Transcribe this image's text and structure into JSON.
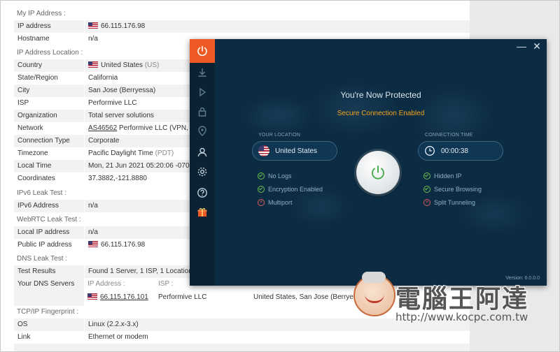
{
  "page": {
    "sections": {
      "my_ip": "My IP Address :",
      "ip_location": "IP Address Location :",
      "ipv6": "IPv6 Leak Test :",
      "webrtc": "WebRTC Leak Test :",
      "dns": "DNS Leak Test :",
      "tcp": "TCP/IP Fingerprint :"
    },
    "rows": {
      "ip_address": {
        "k": "IP address",
        "v": "66.115.176.98"
      },
      "hostname": {
        "k": "Hostname",
        "v": "n/a"
      },
      "country": {
        "k": "Country",
        "v": "United States",
        "v2": "(US)"
      },
      "state": {
        "k": "State/Region",
        "v": "California"
      },
      "city": {
        "k": "City",
        "v": "San Jose (Berryessa)"
      },
      "isp": {
        "k": "ISP",
        "v": "Performive LLC"
      },
      "org": {
        "k": "Organization",
        "v": "Total server solutions"
      },
      "network": {
        "k": "Network",
        "v_link": "AS46562",
        "v": "Performive LLC (VPN, A1"
      },
      "conn_type": {
        "k": "Connection Type",
        "v": "Corporate"
      },
      "timezone": {
        "k": "Timezone",
        "v": "Pacific Daylight Time",
        "v2": "(PDT)"
      },
      "local_time": {
        "k": "Local Time",
        "v": "Mon, 21 Jun 2021 05:20:06 -0700"
      },
      "coords": {
        "k": "Coordinates",
        "v": "37.3882,-121.8880"
      },
      "ipv6_addr": {
        "k": "IPv6 Address",
        "v": "n/a"
      },
      "local_ip": {
        "k": "Local IP address",
        "v": "n/a"
      },
      "public_ip": {
        "k": "Public IP address",
        "v": "66.115.176.98"
      },
      "test_results": {
        "k": "Test Results",
        "v": "Found 1 Server, 1 ISP, 1 Location"
      },
      "dns_servers": {
        "k": "Your DNS Servers",
        "h1": "IP Address :",
        "h2": "ISP :",
        "h3": "Location :"
      },
      "dns_entry": {
        "ip": "66.115.176.101",
        "isp": "Performive LLC",
        "loc": "United States, San Jose (Berryessa)"
      },
      "os": {
        "k": "OS",
        "v": "Linux (2.2.x-3.x)"
      },
      "link": {
        "k": "Link",
        "v": "Ethernet or modem"
      }
    }
  },
  "vpn": {
    "minimize": "—",
    "close": "✕",
    "title": "You're Now Protected",
    "subtitle": "Secure Connection Enabled",
    "your_location_label": "YOUR LOCATION",
    "location": "United States",
    "connection_time_label": "CONNECTION TIME",
    "connection_time": "00:00:38",
    "features_left": [
      "No Logs",
      "Encryption Enabled",
      "Multiport"
    ],
    "features_right": [
      "Hidden IP",
      "Secure Browsing",
      "Split Tunneling"
    ],
    "version": "Version: 6.0.0.0",
    "colors": {
      "accent": "#ef5a24",
      "bg": "#0c2c43",
      "warning": "#f2a51a",
      "ok": "#6bbf4c",
      "off": "#e0585a"
    }
  },
  "watermark": {
    "brand": "電腦王阿達",
    "url": "http://www.kocpc.com.tw"
  }
}
